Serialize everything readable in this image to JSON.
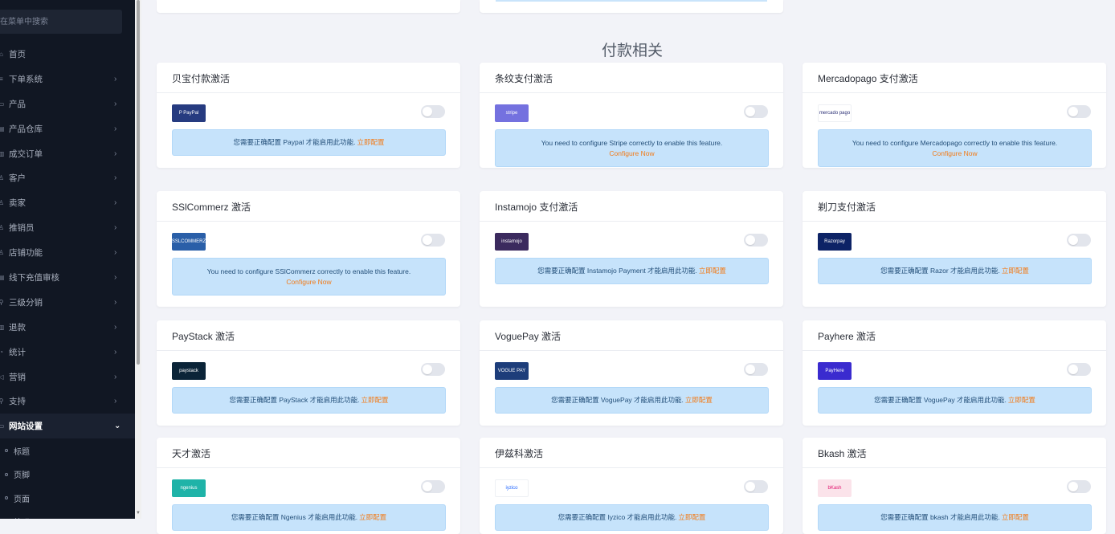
{
  "sidebar": {
    "search_placeholder": "在菜单中搜索",
    "items": [
      {
        "icon": "⌂",
        "label": "首页",
        "chevron": ""
      },
      {
        "icon": "≡",
        "label": "下单系统",
        "chevron": "›"
      },
      {
        "icon": "▭",
        "label": "产品",
        "chevron": "›"
      },
      {
        "icon": "▤",
        "label": "产品仓库",
        "chevron": "›"
      },
      {
        "icon": "▥",
        "label": "成交订单",
        "chevron": "›"
      },
      {
        "icon": "♙",
        "label": "客户",
        "chevron": "›"
      },
      {
        "icon": "♙",
        "label": "卖家",
        "chevron": "›"
      },
      {
        "icon": "♙",
        "label": "推销员",
        "chevron": "›"
      },
      {
        "icon": "♙",
        "label": "店铺功能",
        "chevron": "›"
      },
      {
        "icon": "▤",
        "label": "线下充值审核",
        "chevron": "›"
      },
      {
        "icon": "⚲",
        "label": "三级分销",
        "chevron": "›"
      },
      {
        "icon": "▥",
        "label": "退款",
        "chevron": "›"
      },
      {
        "icon": "◔",
        "label": "统计",
        "chevron": "›"
      },
      {
        "icon": "◁",
        "label": "营销",
        "chevron": "›"
      },
      {
        "icon": "⚲",
        "label": "支持",
        "chevron": "›"
      },
      {
        "icon": "▭",
        "label": "网站设置",
        "chevron": "⌄"
      }
    ],
    "sub_items": [
      {
        "label": "标题"
      },
      {
        "label": "页脚"
      },
      {
        "label": "页面"
      },
      {
        "label": "外观"
      }
    ]
  },
  "section_title": "付款相关",
  "colors": {
    "accent_link": "#f27b18",
    "alert_bg": "#c6e3fb",
    "sidebar_bg": "#111723"
  },
  "cards": [
    {
      "title": "贝宝付款激活",
      "logo": {
        "name": "paypal-logo",
        "text": "P PayPal",
        "bg": "#263b80",
        "color": "#ffffff"
      },
      "message": "您需要正确配置 Paypal 才能启用此功能.",
      "link": "立即配置",
      "layout": "short"
    },
    {
      "title": "条纹支付激活",
      "logo": {
        "name": "stripe-logo",
        "text": "stripe",
        "bg": "#7471df",
        "color": "#ffffff"
      },
      "message": "You need to configure Stripe correctly to enable this feature.",
      "link": "Configure Now",
      "layout": "tall"
    },
    {
      "title": "Mercadopago 支付激活",
      "logo": {
        "name": "mercadopago-logo",
        "text": "mercado pago",
        "bg": "#ffffff",
        "color": "#2d3277"
      },
      "message": "You need to configure Mercadopago correctly to enable this feature.",
      "link": "Configure Now",
      "layout": "tall"
    },
    {
      "title": "SSlCommerz 激活",
      "logo": {
        "name": "sslcommerz-logo",
        "text": "SSLCOMMERZ",
        "bg": "#2a5fa8",
        "color": "#ffffff"
      },
      "message": "You need to configure SSlCommerz correctly to enable this feature.",
      "link": "Configure Now",
      "layout": "tall"
    },
    {
      "title": "Instamojo 支付激活",
      "logo": {
        "name": "instamojo-logo",
        "text": "instamojo",
        "bg": "#3b2a5e",
        "color": "#ffffff"
      },
      "message": "您需要正确配置 Instamojo Payment 才能启用此功能.",
      "link": "立即配置",
      "layout": "short"
    },
    {
      "title": "剃刀支付激活",
      "logo": {
        "name": "razorpay-logo",
        "text": "Razorpay",
        "bg": "#0d2366",
        "color": "#ffffff"
      },
      "message": "您需要正确配置 Razor 才能启用此功能.",
      "link": "立即配置",
      "layout": "short"
    },
    {
      "title": "PayStack 激活",
      "logo": {
        "name": "paystack-logo",
        "text": "paystack",
        "bg": "#0b2438",
        "color": "#ffffff"
      },
      "message": "您需要正确配置 PayStack 才能启用此功能.",
      "link": "立即配置",
      "layout": "short"
    },
    {
      "title": "VoguePay 激活",
      "logo": {
        "name": "voguepay-logo",
        "text": "VOGUE PAY",
        "bg": "#1d3d7a",
        "color": "#ffffff"
      },
      "message": "您需要正确配置 VoguePay 才能启用此功能.",
      "link": "立即配置",
      "layout": "short"
    },
    {
      "title": "Payhere 激活",
      "logo": {
        "name": "payhere-logo",
        "text": "PayHere",
        "bg": "#3a2bcf",
        "color": "#ffffff"
      },
      "message": "您需要正确配置 VoguePay 才能启用此功能.",
      "link": "立即配置",
      "layout": "short"
    },
    {
      "title": "天才激活",
      "logo": {
        "name": "ngenius-logo",
        "text": "ngenius",
        "bg": "#1fb3a8",
        "color": "#ffffff"
      },
      "message": "您需要正确配置 Ngenius 才能启用此功能.",
      "link": "立即配置",
      "layout": "short"
    },
    {
      "title": "伊兹科激活",
      "logo": {
        "name": "iyzico-logo",
        "text": "iyzico",
        "bg": "#ffffff",
        "color": "#1e64ff"
      },
      "message": "您需要正确配置 Iyzico 才能启用此功能.",
      "link": "立即配置",
      "layout": "short"
    },
    {
      "title": "Bkash 激活",
      "logo": {
        "name": "bkash-logo",
        "text": "bKash",
        "bg": "#fbe3ea",
        "color": "#e2136e"
      },
      "message": "您需要正确配置 bkash 才能启用此功能.",
      "link": "立即配置",
      "layout": "short"
    }
  ]
}
